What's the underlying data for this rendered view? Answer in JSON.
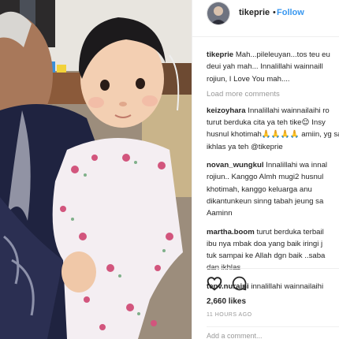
{
  "post": {
    "username": "tikeprie",
    "separator": "•",
    "follow_label": "Follow",
    "likes_text": "2,660 likes",
    "timestamp": "11 HOURS AGO",
    "add_comment_placeholder": "Add a comment..."
  },
  "caption": {
    "user": "tikeprie",
    "text": "Mah...pileleuyan...tos teu eu\ndeui yah mah... Innalillahi wainnaill\nrojiun, I Love You mah...."
  },
  "load_more_label": "Load more comments",
  "comments": [
    {
      "user": "keizoyhara",
      "text": "Innalillahi wainnailaihi ro\nturut berduka cita ya teh tike😌 Insy\nhusnul khotimah🙏🙏🙏🙏 amiin, yg sa\nikhlas ya teh @tikeprie"
    },
    {
      "user": "novan_wungkul",
      "text": "Innalillahi wa innal\nrojiun.. Kanggo Almh mugi2 husnul\nkhotimah, kanggo keluarga anu\ndikantunkeun sinng tabah jeung sa\nAaminn"
    },
    {
      "user": "martha.boom",
      "text": "turut berduka terbail\nibu nya mbak doa yang baik iringi j\ntuk sampai ke Allah dgn baik ..saba\ndan ikhlas"
    },
    {
      "user": "tenv.nuraini",
      "text": "innalillahi wainnailaihi"
    }
  ],
  "icons": {
    "like": "heart-outline-icon",
    "comment": "speech-bubble-icon"
  },
  "colors": {
    "link_blue": "#3897f0",
    "muted_gray": "#999999",
    "text": "#262626",
    "border": "#efefef"
  }
}
